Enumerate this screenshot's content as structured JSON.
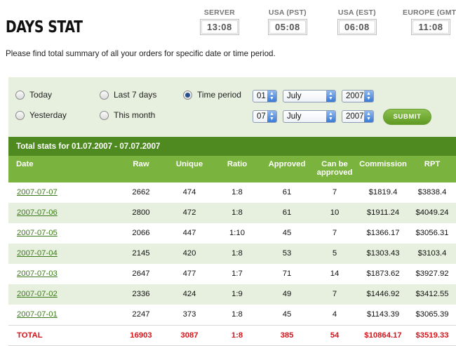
{
  "page_title": "DAYS STAT",
  "intro": "Please find total summary of all your orders for specific date or time period.",
  "clocks": [
    {
      "label": "SERVER",
      "time": "13:08"
    },
    {
      "label": "USA (PST)",
      "time": "05:08"
    },
    {
      "label": "USA (EST)",
      "time": "06:08"
    },
    {
      "label": "EUROPE (GMT)",
      "time": "11:08"
    }
  ],
  "filters": {
    "today": "Today",
    "yesterday": "Yesterday",
    "last7": "Last 7 days",
    "this_month": "This month",
    "time_period": "Time period",
    "selected": "time_period",
    "from": {
      "day": "01",
      "month": "July",
      "year": "2007"
    },
    "to": {
      "day": "07",
      "month": "July",
      "year": "2007"
    },
    "submit": "SUBMIT"
  },
  "colors": {
    "accent": "#7ab43e",
    "dark_accent": "#4e8a1f",
    "total_text": "#d4141b",
    "link": "#3d7a1b"
  },
  "table": {
    "caption": "Total stats for 01.07.2007 - 07.07.2007",
    "headers": {
      "date": "Date",
      "raw": "Raw",
      "unique": "Unique",
      "ratio": "Ratio",
      "approved": "Approved",
      "can_be_1": "Can be",
      "can_be_2": "approved",
      "commission": "Commission",
      "rpt": "RPT"
    },
    "rows": [
      {
        "date": "2007-07-07",
        "raw": "2662",
        "unique": "474",
        "ratio": "1:8",
        "approved": "61",
        "can_be": "7",
        "commission": "$1819.4",
        "rpt": "$3838.4"
      },
      {
        "date": "2007-07-06",
        "raw": "2800",
        "unique": "472",
        "ratio": "1:8",
        "approved": "61",
        "can_be": "10",
        "commission": "$1911.24",
        "rpt": "$4049.24"
      },
      {
        "date": "2007-07-05",
        "raw": "2066",
        "unique": "447",
        "ratio": "1:10",
        "approved": "45",
        "can_be": "7",
        "commission": "$1366.17",
        "rpt": "$3056.31"
      },
      {
        "date": "2007-07-04",
        "raw": "2145",
        "unique": "420",
        "ratio": "1:8",
        "approved": "53",
        "can_be": "5",
        "commission": "$1303.43",
        "rpt": "$3103.4"
      },
      {
        "date": "2007-07-03",
        "raw": "2647",
        "unique": "477",
        "ratio": "1:7",
        "approved": "71",
        "can_be": "14",
        "commission": "$1873.62",
        "rpt": "$3927.92"
      },
      {
        "date": "2007-07-02",
        "raw": "2336",
        "unique": "424",
        "ratio": "1:9",
        "approved": "49",
        "can_be": "7",
        "commission": "$1446.92",
        "rpt": "$3412.55"
      },
      {
        "date": "2007-07-01",
        "raw": "2247",
        "unique": "373",
        "ratio": "1:8",
        "approved": "45",
        "can_be": "4",
        "commission": "$1143.39",
        "rpt": "$3065.39"
      }
    ],
    "total": {
      "label": "TOTAL",
      "raw": "16903",
      "unique": "3087",
      "ratio": "1:8",
      "approved": "385",
      "can_be": "54",
      "commission": "$10864.17",
      "rpt": "$3519.33"
    }
  }
}
